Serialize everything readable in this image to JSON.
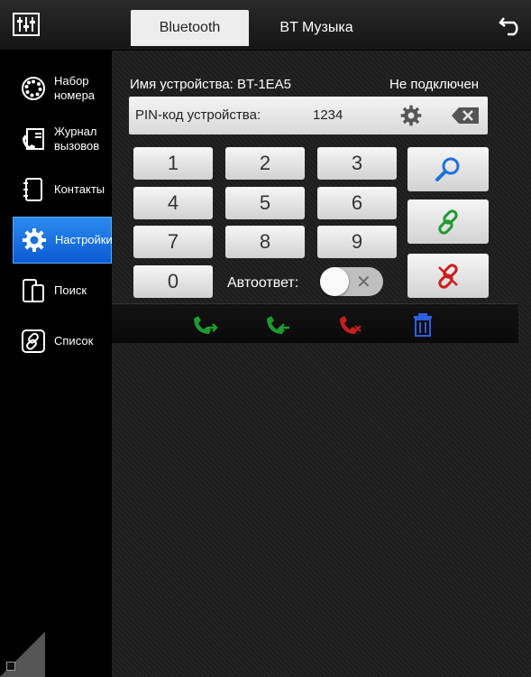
{
  "header": {
    "tabs": [
      {
        "label": "Bluetooth",
        "active": true
      },
      {
        "label": "BT Музыка",
        "active": false
      }
    ]
  },
  "sidebar": {
    "items": [
      {
        "label": "Набор\nномера",
        "icon": "dial-icon"
      },
      {
        "label": "Журнал\nвызовов",
        "icon": "call-log-icon"
      },
      {
        "label": "Контакты",
        "icon": "contacts-icon"
      },
      {
        "label": "Настройки",
        "icon": "gear-icon",
        "active": true
      },
      {
        "label": "Поиск",
        "icon": "phone-search-icon"
      },
      {
        "label": "Список",
        "icon": "link-list-icon"
      }
    ]
  },
  "device": {
    "name_label": "Имя устройства: BT-1EA5",
    "status": "Не подключен"
  },
  "pin": {
    "label": "PIN-код устройства:",
    "value": "1234"
  },
  "keypad": {
    "keys": [
      "1",
      "2",
      "3",
      "4",
      "5",
      "6",
      "7",
      "8",
      "9",
      "0"
    ]
  },
  "autoanswer": {
    "label": "Автоответ:",
    "enabled": false
  },
  "actions": [
    "search-icon",
    "connect-link-icon",
    "disconnect-link-icon"
  ],
  "callbar": [
    "outgoing-call-icon",
    "incoming-call-icon",
    "missed-call-icon",
    "trash-icon"
  ],
  "colors": {
    "accent_blue": "#1e7be6",
    "call_green": "#1f9a2f",
    "call_red": "#c81e1e",
    "trash_blue": "#2e5fe0"
  }
}
